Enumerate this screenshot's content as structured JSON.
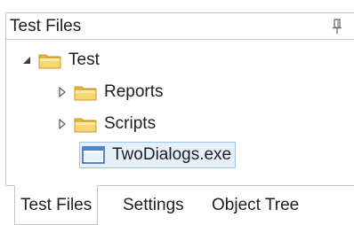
{
  "panel": {
    "title": "Test Files",
    "pin_icon": "pin-icon"
  },
  "tree": {
    "root": {
      "label": "Test",
      "expanded": true,
      "icon": "folder-icon"
    },
    "children": [
      {
        "label": "Reports",
        "expanded": false,
        "icon": "folder-icon"
      },
      {
        "label": "Scripts",
        "expanded": false,
        "icon": "folder-icon"
      },
      {
        "label": "TwoDialogs.exe",
        "selected": true,
        "icon": "exe-window-icon"
      }
    ]
  },
  "tabs": [
    {
      "label": "Test Files",
      "active": true
    },
    {
      "label": "Settings",
      "active": false
    },
    {
      "label": "Object Tree",
      "active": false
    }
  ],
  "colors": {
    "folder": "#f2cc5a",
    "selection_bg": "#e6f0fa",
    "selection_border": "#9fc4e8",
    "border": "#bfc5cc"
  }
}
